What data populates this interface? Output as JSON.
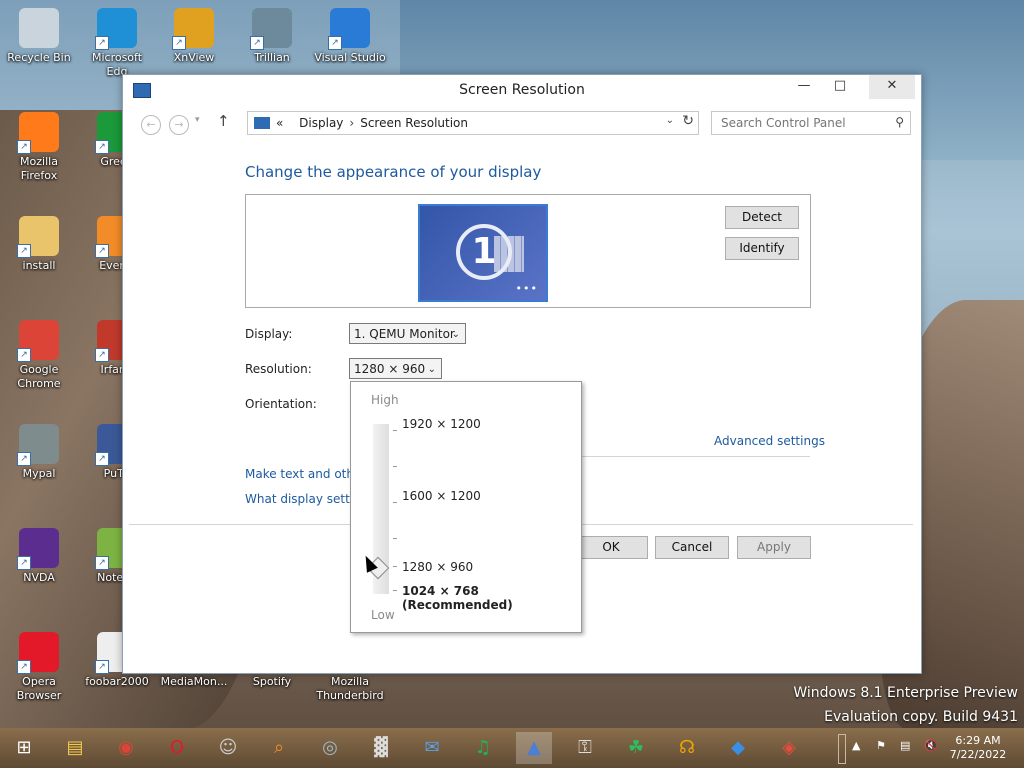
{
  "desktop": {
    "icons": [
      {
        "label": "Recycle Bin",
        "color": "#c9d4dc"
      },
      {
        "label": "Microsoft Edg",
        "color": "#1f8fd6"
      },
      {
        "label": "XnView",
        "color": "#e0a020"
      },
      {
        "label": "Trillian",
        "color": "#6c8a9c"
      },
      {
        "label": "Visual Studio",
        "color": "#2a7bd6"
      },
      {
        "label": "Mozilla Firefox",
        "color": "#ff7a1a"
      },
      {
        "label": "Green",
        "color": "#1a9a3a"
      },
      {
        "label": "install",
        "color": "#e9c46a"
      },
      {
        "label": "Everyt",
        "color": "#f28c28"
      },
      {
        "label": "Google Chrome",
        "color": "#db4437"
      },
      {
        "label": "IrfanV",
        "color": "#c0392b"
      },
      {
        "label": "Mypal",
        "color": "#7f8c8d"
      },
      {
        "label": "PuTT",
        "color": "#3b5998"
      },
      {
        "label": "NVDA",
        "color": "#5b2d8e"
      },
      {
        "label": "Notepa",
        "color": "#7cb342"
      },
      {
        "label": "Opera Browser",
        "color": "#e3192a"
      },
      {
        "label": "foobar2000",
        "color": "#eeeeee"
      },
      {
        "label": "MediaMon...",
        "color": "#3c7fb1"
      },
      {
        "label": "Spotify",
        "color": "#1db954"
      },
      {
        "label": "Mozilla Thunderbird",
        "color": "#2a6fd0"
      }
    ],
    "watermark_line1": "Windows 8.1 Enterprise Preview",
    "watermark_line2": "Evaluation copy. Build 9431"
  },
  "window": {
    "title": "Screen Resolution",
    "minimize_glyph": "—",
    "maximize_glyph": "□",
    "close_glyph": "✕",
    "breadcrumb_prefix": "«",
    "breadcrumb_1": "Display",
    "breadcrumb_sep": "›",
    "breadcrumb_2": "Screen Resolution",
    "search_placeholder": "Search Control Panel"
  },
  "content": {
    "heading": "Change the appearance of your display",
    "monitor_number": "1",
    "detect_label": "Detect",
    "identify_label": "Identify",
    "display_label": "Display:",
    "display_value": "1. QEMU Monitor",
    "resolution_label": "Resolution:",
    "resolution_value": "1280 × 960",
    "orientation_label": "Orientation:",
    "advanced_link": "Advanced settings",
    "link_text_size": "Make text and other",
    "link_what_display": "What display setting",
    "ok_label": "OK",
    "cancel_label": "Cancel",
    "apply_label": "Apply"
  },
  "resolution_popup": {
    "high_label": "High",
    "low_label": "Low",
    "options": [
      "1920 × 1200",
      "1600 × 1200",
      "1280 × 960",
      "1024 × 768 (Recommended)"
    ],
    "selected": "1280 × 960"
  },
  "taskbar": {
    "apps": [
      "start",
      "file-explorer",
      "chrome",
      "opera",
      "mypal",
      "everything",
      "trillian",
      "resource-monitor",
      "thunderbird",
      "spotify",
      "screen-resolution",
      "keepass",
      "evernote",
      "audacity",
      "visual-studio",
      "app-store"
    ],
    "time": "6:29 AM",
    "date": "7/22/2022"
  }
}
